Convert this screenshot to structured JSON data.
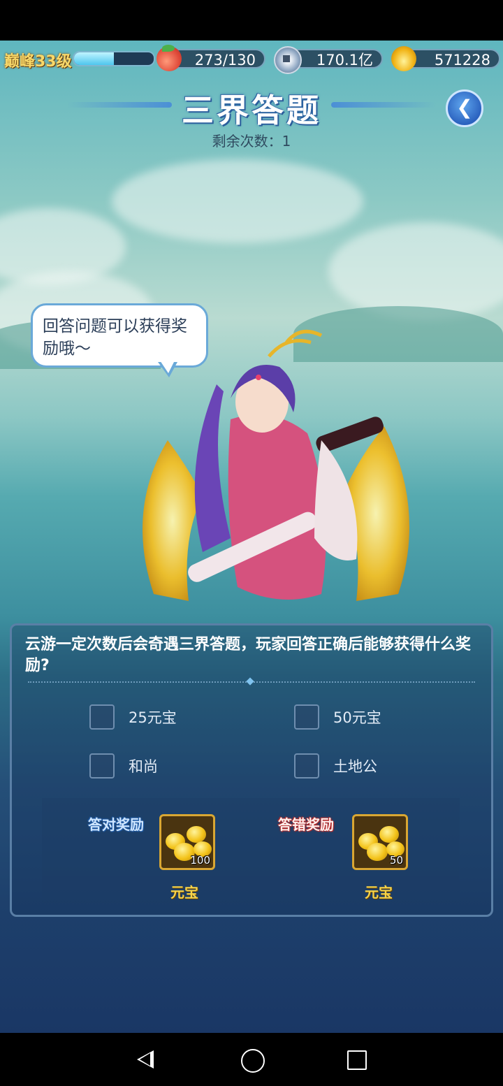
{
  "hud": {
    "level": "巅峰33级",
    "xp_fraction": 0.5,
    "peach": "273/130",
    "silver": "170.1亿",
    "gold_ingot": "571228"
  },
  "header": {
    "title": "三界答题",
    "remaining": "剩余次数：1",
    "back_icon": "back-arrow-icon"
  },
  "npc": {
    "bubble_text": "回答问题可以获得奖励哦～"
  },
  "quiz": {
    "question": "云游一定次数后会奇遇三界答题，玩家回答正确后能够获得什么奖励?",
    "options": [
      "25元宝",
      "50元宝",
      "和尚",
      "土地公"
    ]
  },
  "rewards": {
    "correct_label": "答对奖励",
    "wrong_label": "答错奖励",
    "correct_item": {
      "name": "元宝",
      "qty": "100"
    },
    "wrong_item": {
      "name": "元宝",
      "qty": "50"
    }
  },
  "colors": {
    "accent_gold": "#f7d44a",
    "panel_border": "#5a7fa6",
    "title_blue": "#2a5a98"
  }
}
